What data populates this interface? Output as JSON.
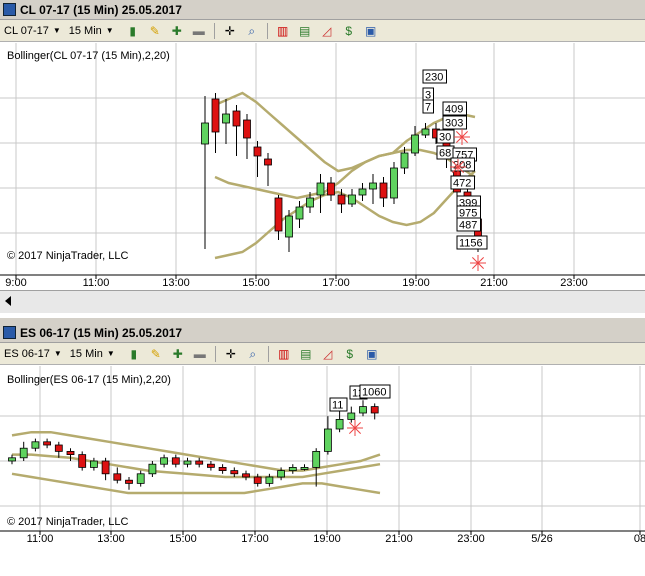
{
  "top_window": {
    "title": "CL 07-17 (15 Min)  25.05.2017",
    "instrument": "CL 07-17",
    "period": "15 Min",
    "indicator_label": "Bollinger(CL 07-17 (15 Min),2,20)",
    "copyright": "© 2017 NinjaTrader, LLC",
    "x_ticks": [
      "9:00",
      "11:00",
      "13:00",
      "15:00",
      "17:00",
      "19:00",
      "21:00",
      "23:00"
    ],
    "volume_labels": [
      "230",
      "3",
      "7",
      "409",
      "303",
      "30",
      "68",
      "757",
      "208",
      "472",
      "399",
      "975",
      "487",
      "1156"
    ]
  },
  "bottom_window": {
    "title": "ES 06-17 (15 Min)  25.05.2017",
    "instrument": "ES 06-17",
    "period": "15 Min",
    "indicator_label": "Bollinger(ES 06-17 (15 Min),2,20)",
    "copyright": "© 2017 NinjaTrader, LLC",
    "x_ticks": [
      "11:00",
      "13:00",
      "15:00",
      "17:00",
      "19:00",
      "21:00",
      "23:00",
      "5/26",
      "08"
    ],
    "volume_labels": [
      "11",
      "12",
      "1060"
    ]
  },
  "toolbar_icons": [
    "bar-type-icon",
    "pencil-draw-icon",
    "zoom-in-icon",
    "zoom-out-icon",
    "crosshair-icon",
    "magnifier-icon",
    "indicators-icon",
    "strategies-icon",
    "chart-style-icon",
    "order-icon",
    "properties-icon"
  ],
  "colors": {
    "up": "#5fd35f",
    "down": "#dd1111",
    "band": "#b5ab6e",
    "grid": "#c8c8c8"
  },
  "chart_data": [
    {
      "type": "candlestick",
      "title": "CL 07-17 (15 Min)  25.05.2017",
      "x_ticks": [
        "9:00",
        "11:00",
        "13:00",
        "15:00",
        "17:00",
        "19:00",
        "21:00",
        "23:00"
      ],
      "candles": [
        {
          "o": 6,
          "c": 20,
          "h": 38,
          "l": -64
        },
        {
          "o": 36,
          "c": 14,
          "h": 40,
          "l": 0
        },
        {
          "o": 20,
          "c": 26,
          "h": 36,
          "l": 6
        },
        {
          "o": 28,
          "c": 18,
          "h": 32,
          "l": -2
        },
        {
          "o": 22,
          "c": 10,
          "h": 26,
          "l": -4
        },
        {
          "o": 4,
          "c": -2,
          "h": 8,
          "l": -16
        },
        {
          "o": -4,
          "c": -8,
          "h": 0,
          "l": -22
        },
        {
          "o": -30,
          "c": -52,
          "h": -28,
          "l": -58
        },
        {
          "o": -56,
          "c": -42,
          "h": -38,
          "l": -66
        },
        {
          "o": -44,
          "c": -36,
          "h": -32,
          "l": -50
        },
        {
          "o": -36,
          "c": -30,
          "h": -26,
          "l": -40
        },
        {
          "o": -28,
          "c": -20,
          "h": -14,
          "l": -40
        },
        {
          "o": -20,
          "c": -28,
          "h": -16,
          "l": -32
        },
        {
          "o": -28,
          "c": -34,
          "h": -24,
          "l": -40
        },
        {
          "o": -34,
          "c": -28,
          "h": -24,
          "l": -36
        },
        {
          "o": -28,
          "c": -24,
          "h": -20,
          "l": -32
        },
        {
          "o": -24,
          "c": -20,
          "h": -14,
          "l": -34
        },
        {
          "o": -20,
          "c": -30,
          "h": -16,
          "l": -36
        },
        {
          "o": -30,
          "c": -10,
          "h": -6,
          "l": -34
        },
        {
          "o": -10,
          "c": 0,
          "h": 4,
          "l": -14
        },
        {
          "o": 0,
          "c": 12,
          "h": 18,
          "l": -2
        },
        {
          "o": 12,
          "c": 16,
          "h": 20,
          "l": 10
        },
        {
          "o": 16,
          "c": 10,
          "h": 20,
          "l": 6
        },
        {
          "o": 10,
          "c": -4,
          "h": 12,
          "l": -10
        },
        {
          "o": -4,
          "c": -26,
          "h": 0,
          "l": -32
        },
        {
          "o": -26,
          "c": -44,
          "h": -22,
          "l": -52
        },
        {
          "o": -44,
          "c": -60,
          "h": -40,
          "l": -66
        }
      ],
      "bands_upper": [
        32,
        36,
        40,
        34,
        26,
        18,
        10,
        2,
        -6,
        -12,
        -10,
        -6,
        -2,
        0,
        8,
        14,
        20,
        24,
        26,
        24
      ],
      "bands_lower": [
        -70,
        -68,
        -66,
        -60,
        -52,
        -44,
        -38,
        -32,
        -28,
        -26,
        -30,
        -36,
        -42,
        -46,
        -48,
        -46,
        -40,
        -30,
        -20,
        -12
      ],
      "bands_mid": [
        -16,
        -20,
        -22,
        -24,
        -26,
        -28,
        -30,
        -28,
        -26,
        -20,
        -12,
        -6,
        -2,
        0,
        2,
        2,
        0,
        -4,
        -10,
        -16
      ]
    },
    {
      "type": "candlestick",
      "title": "ES 06-17 (15 Min)  25.05.2017",
      "x_ticks": [
        "11:00",
        "13:00",
        "15:00",
        "17:00",
        "19:00",
        "21:00",
        "23:00",
        "5/26",
        "08"
      ],
      "candles": [
        {
          "o": 0,
          "c": 2,
          "h": 4,
          "l": -2
        },
        {
          "o": 2,
          "c": 8,
          "h": 12,
          "l": 0
        },
        {
          "o": 8,
          "c": 12,
          "h": 14,
          "l": 6
        },
        {
          "o": 12,
          "c": 10,
          "h": 14,
          "l": 8
        },
        {
          "o": 10,
          "c": 6,
          "h": 12,
          "l": 2
        },
        {
          "o": 6,
          "c": 4,
          "h": 8,
          "l": 0
        },
        {
          "o": 4,
          "c": -4,
          "h": 6,
          "l": -6
        },
        {
          "o": -4,
          "c": 0,
          "h": 2,
          "l": -6
        },
        {
          "o": 0,
          "c": -8,
          "h": 2,
          "l": -12
        },
        {
          "o": -8,
          "c": -12,
          "h": -4,
          "l": -14
        },
        {
          "o": -12,
          "c": -14,
          "h": -10,
          "l": -18
        },
        {
          "o": -14,
          "c": -8,
          "h": -6,
          "l": -16
        },
        {
          "o": -8,
          "c": -2,
          "h": 0,
          "l": -10
        },
        {
          "o": -2,
          "c": 2,
          "h": 4,
          "l": -4
        },
        {
          "o": 2,
          "c": -2,
          "h": 4,
          "l": -4
        },
        {
          "o": -2,
          "c": 0,
          "h": 2,
          "l": -4
        },
        {
          "o": 0,
          "c": -2,
          "h": 2,
          "l": -4
        },
        {
          "o": -2,
          "c": -4,
          "h": 0,
          "l": -6
        },
        {
          "o": -4,
          "c": -6,
          "h": -2,
          "l": -8
        },
        {
          "o": -6,
          "c": -8,
          "h": -4,
          "l": -10
        },
        {
          "o": -8,
          "c": -10,
          "h": -6,
          "l": -12
        },
        {
          "o": -10,
          "c": -14,
          "h": -8,
          "l": -16
        },
        {
          "o": -14,
          "c": -10,
          "h": -8,
          "l": -16
        },
        {
          "o": -10,
          "c": -6,
          "h": -4,
          "l": -12
        },
        {
          "o": -6,
          "c": -4,
          "h": -2,
          "l": -8
        },
        {
          "o": -4,
          "c": -4,
          "h": -2,
          "l": -6
        },
        {
          "o": -4,
          "c": 6,
          "h": 8,
          "l": -16
        },
        {
          "o": 6,
          "c": 20,
          "h": 28,
          "l": 4
        },
        {
          "o": 20,
          "c": 26,
          "h": 32,
          "l": 18
        },
        {
          "o": 26,
          "c": 30,
          "h": 34,
          "l": 24
        },
        {
          "o": 30,
          "c": 34,
          "h": 38,
          "l": 28
        },
        {
          "o": 34,
          "c": 30,
          "h": 36,
          "l": 26
        }
      ],
      "bands_upper": [
        16,
        18,
        18,
        16,
        14,
        12,
        10,
        8,
        6,
        4,
        2,
        0,
        -2,
        -4,
        -6,
        -6,
        -4,
        -2,
        0,
        4
      ],
      "bands_lower": [
        -8,
        -10,
        -12,
        -14,
        -16,
        -18,
        -20,
        -20,
        -20,
        -20,
        -20,
        -20,
        -20,
        -18,
        -16,
        -14,
        -14,
        -16,
        -18,
        -20
      ],
      "bands_mid": [
        4,
        4,
        3,
        2,
        0,
        -2,
        -4,
        -6,
        -7,
        -8,
        -9,
        -10,
        -10,
        -10,
        -10,
        -10,
        -8,
        -6,
        -4,
        -2
      ]
    }
  ]
}
